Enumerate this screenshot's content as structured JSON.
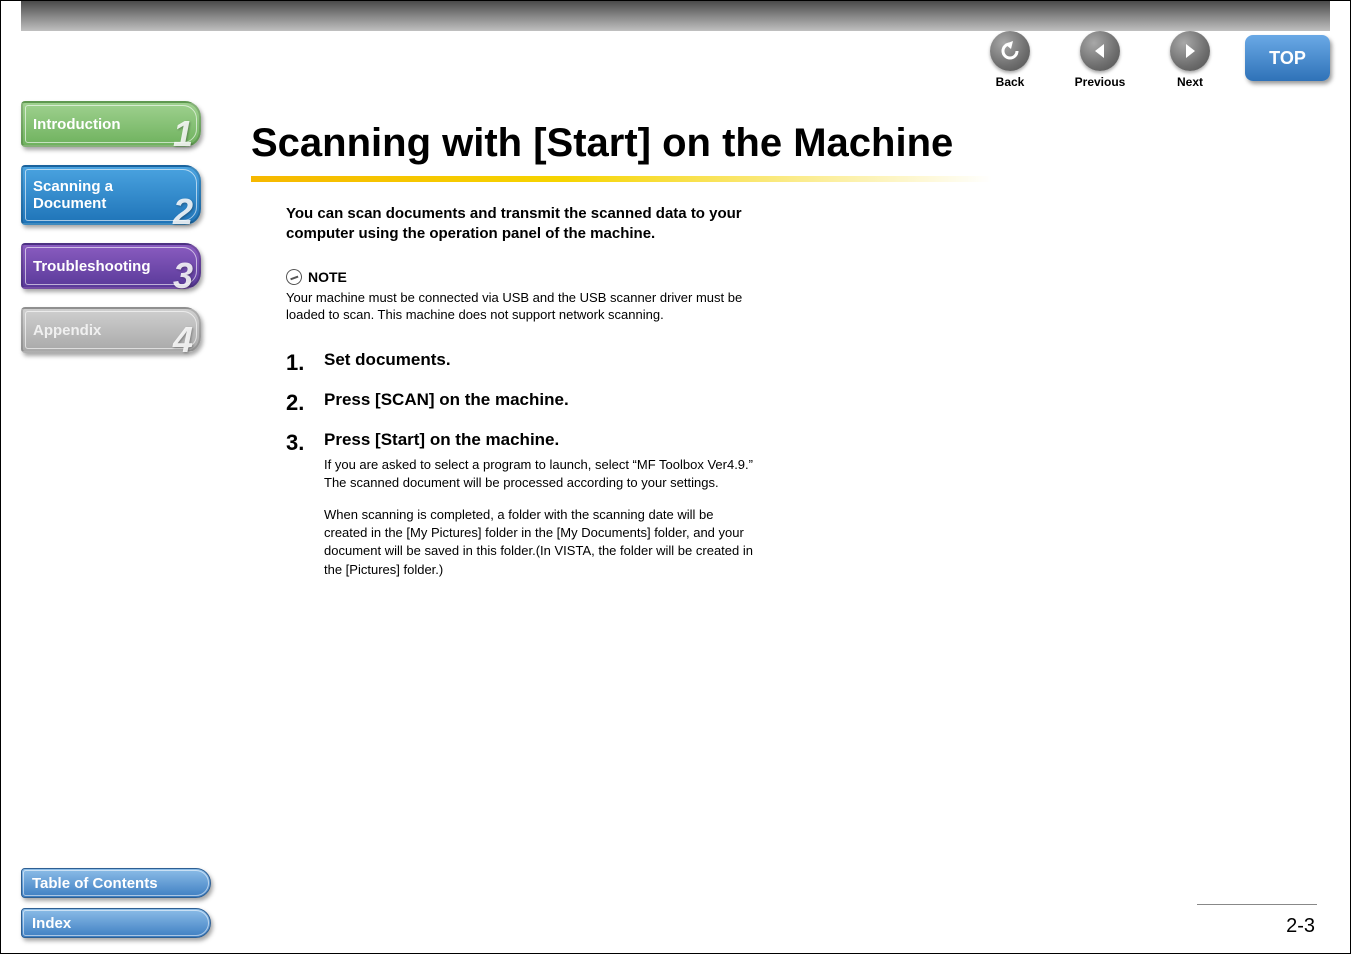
{
  "nav": {
    "back": {
      "label": "Back"
    },
    "previous": {
      "label": "Previous"
    },
    "next": {
      "label": "Next"
    },
    "top": {
      "label": "TOP"
    }
  },
  "sidebar": {
    "tabs": [
      {
        "label": "Introduction",
        "num": "1"
      },
      {
        "label": "Scanning a Document",
        "num": "2"
      },
      {
        "label": "Troubleshooting",
        "num": "3"
      },
      {
        "label": "Appendix",
        "num": "4"
      }
    ],
    "toc": "Table of Contents",
    "index": "Index"
  },
  "content": {
    "title": "Scanning with [Start] on the Machine",
    "intro": "You can scan documents and transmit the scanned data to your computer using the operation panel of the machine.",
    "note": {
      "label": "NOTE",
      "body": "Your machine must be connected via USB and the USB scanner driver must be loaded to scan. This machine does not support network scanning."
    },
    "steps": [
      {
        "num": "1.",
        "title": "Set documents."
      },
      {
        "num": "2.",
        "title": "Press [SCAN] on the machine."
      },
      {
        "num": "3.",
        "title": "Press [Start] on the machine.",
        "para1": "If you are asked to select a program to launch, select “MF Toolbox Ver4.9.” The scanned document will be processed according to your settings.",
        "para2": "When scanning is completed, a folder with the scanning date will be created in the [My Pictures] folder in the [My Documents] folder, and your document will be saved in this folder.(In VISTA, the folder will be created in the [Pictures] folder.)"
      }
    ]
  },
  "page_number": "2-3"
}
